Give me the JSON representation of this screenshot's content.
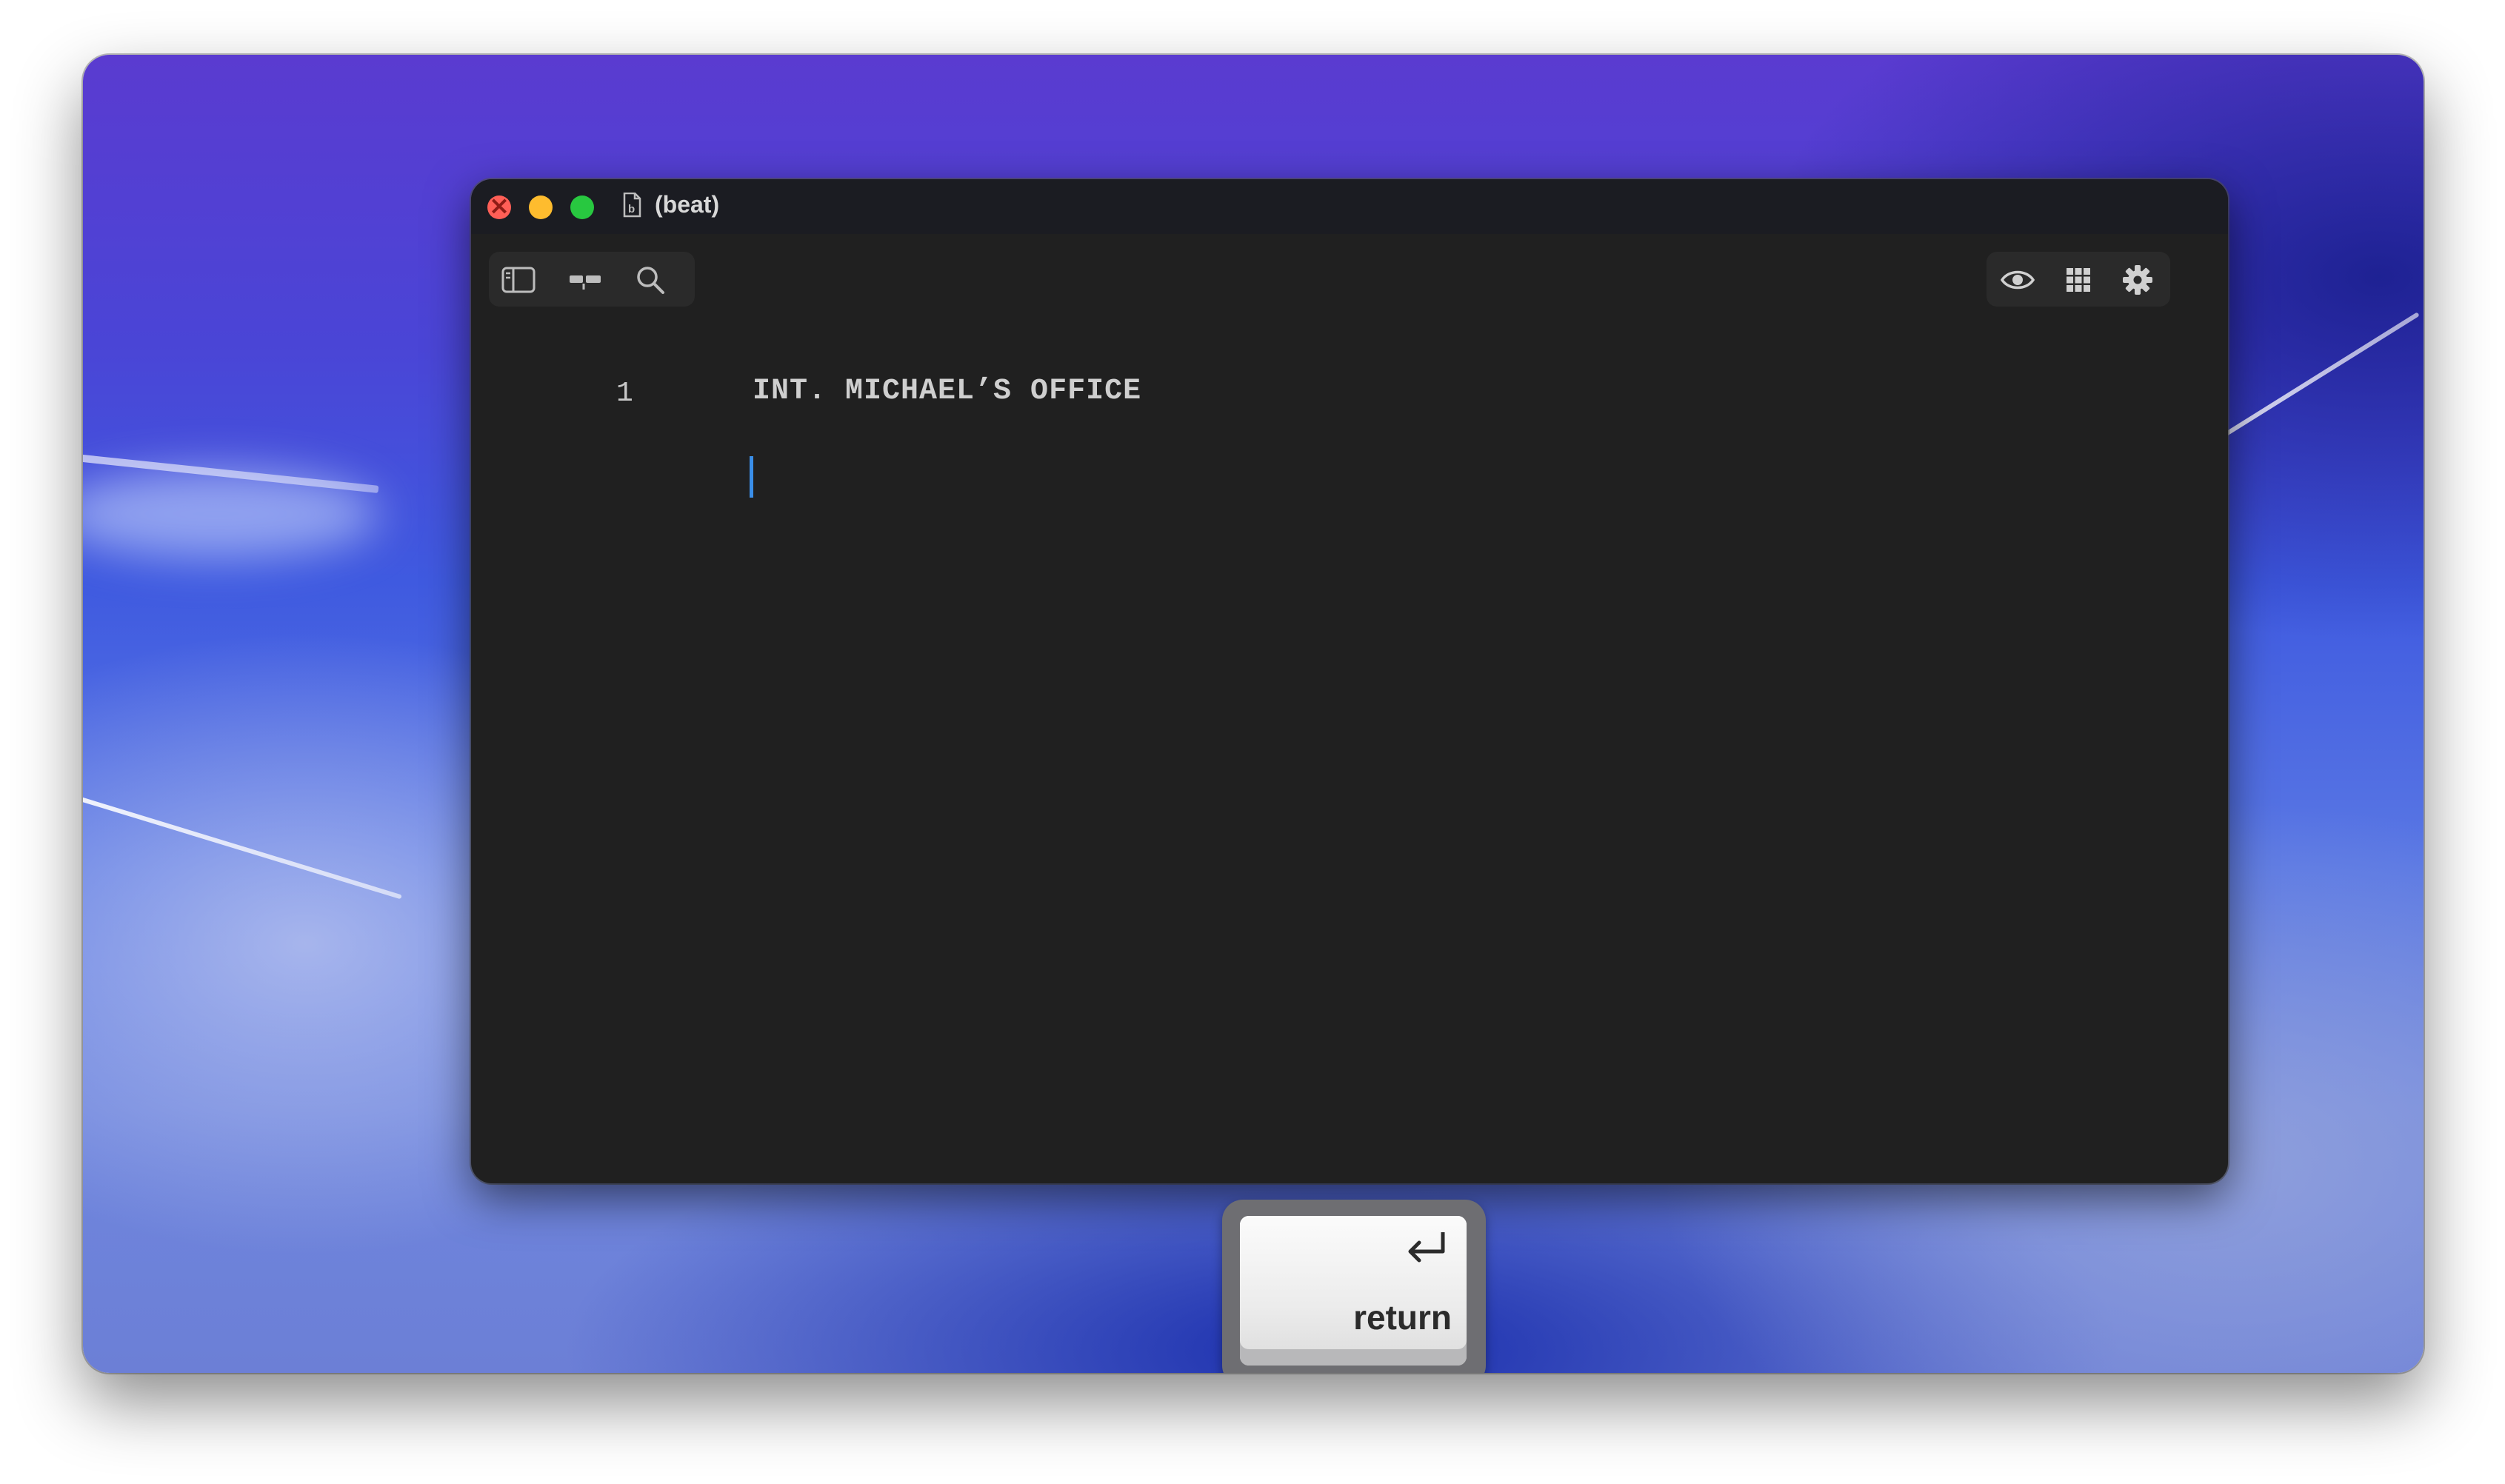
{
  "window": {
    "title": "(beat)",
    "toolbar_left_icons": [
      "sidebar-icon",
      "timeline-icon",
      "search-icon"
    ],
    "toolbar_right_icons": [
      "eye-icon",
      "grid-icon",
      "gear-icon"
    ]
  },
  "editor": {
    "lines": [
      {
        "number": "1",
        "text": "INT. MICHAEL’S OFFICE"
      }
    ]
  },
  "keystroke": {
    "symbol": "↵",
    "label": "return"
  },
  "colors": {
    "editor_bg": "#202020",
    "titlebar_bg": "#1b1c22",
    "caret": "#3a8ee8",
    "close": "#ff5f57",
    "minimize": "#febc2e",
    "zoom": "#28c840"
  }
}
